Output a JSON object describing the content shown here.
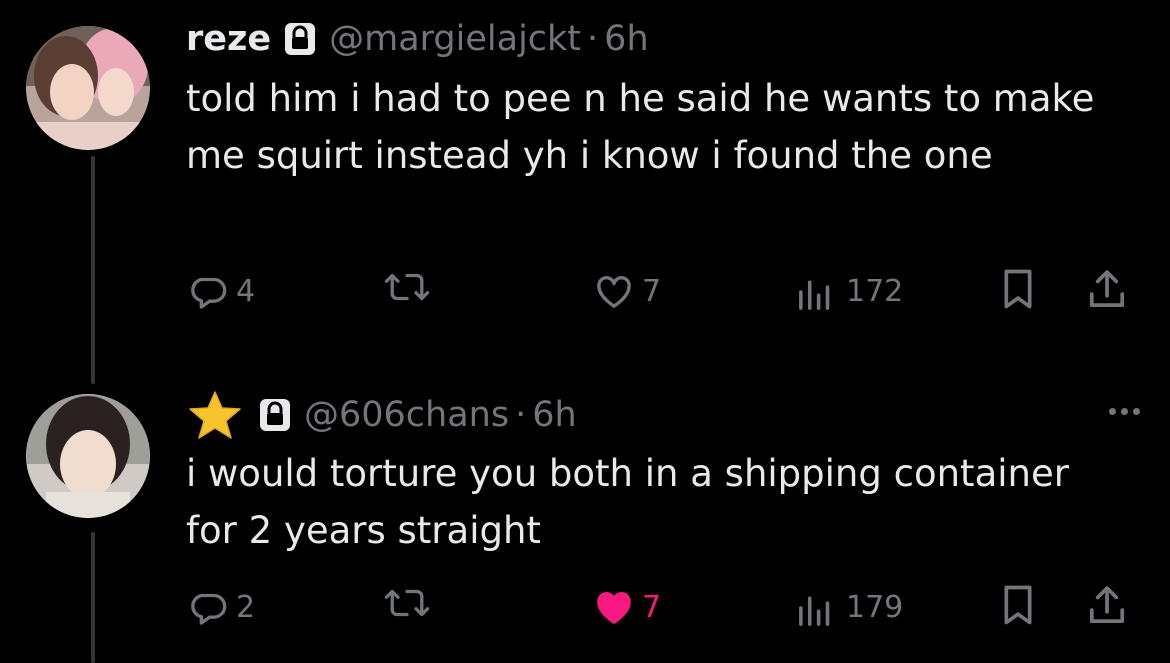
{
  "colors": {
    "background": "#000000",
    "primary_text": "#e7e9ea",
    "secondary_text": "#71767b",
    "thread_line": "#333639",
    "like_active": "#f91880",
    "star": "#f7c52b"
  },
  "tweets": [
    {
      "display_name": "reze",
      "protected_icon": "lock-icon",
      "handle": "@margielajckt",
      "separator": "·",
      "time": "6h",
      "text": "told him i had to pee n he said he wants to make me squirt instead yh i know i found the one",
      "avatar": "avatar-photo",
      "actions": {
        "reply_count": "4",
        "retweet_count": "",
        "like_count": "7",
        "like_active": false,
        "view_count": "172"
      }
    },
    {
      "display_name_icon": "star-emoji-icon",
      "protected_icon": "lock-icon",
      "handle": "@606chans",
      "separator": "·",
      "time": "6h",
      "text": "i would torture you both in a shipping container for 2 years straight",
      "avatar": "avatar-photo",
      "more_icon": "more-options-icon",
      "actions": {
        "reply_count": "2",
        "retweet_count": "",
        "like_count": "7",
        "like_active": true,
        "view_count": "179"
      }
    }
  ]
}
